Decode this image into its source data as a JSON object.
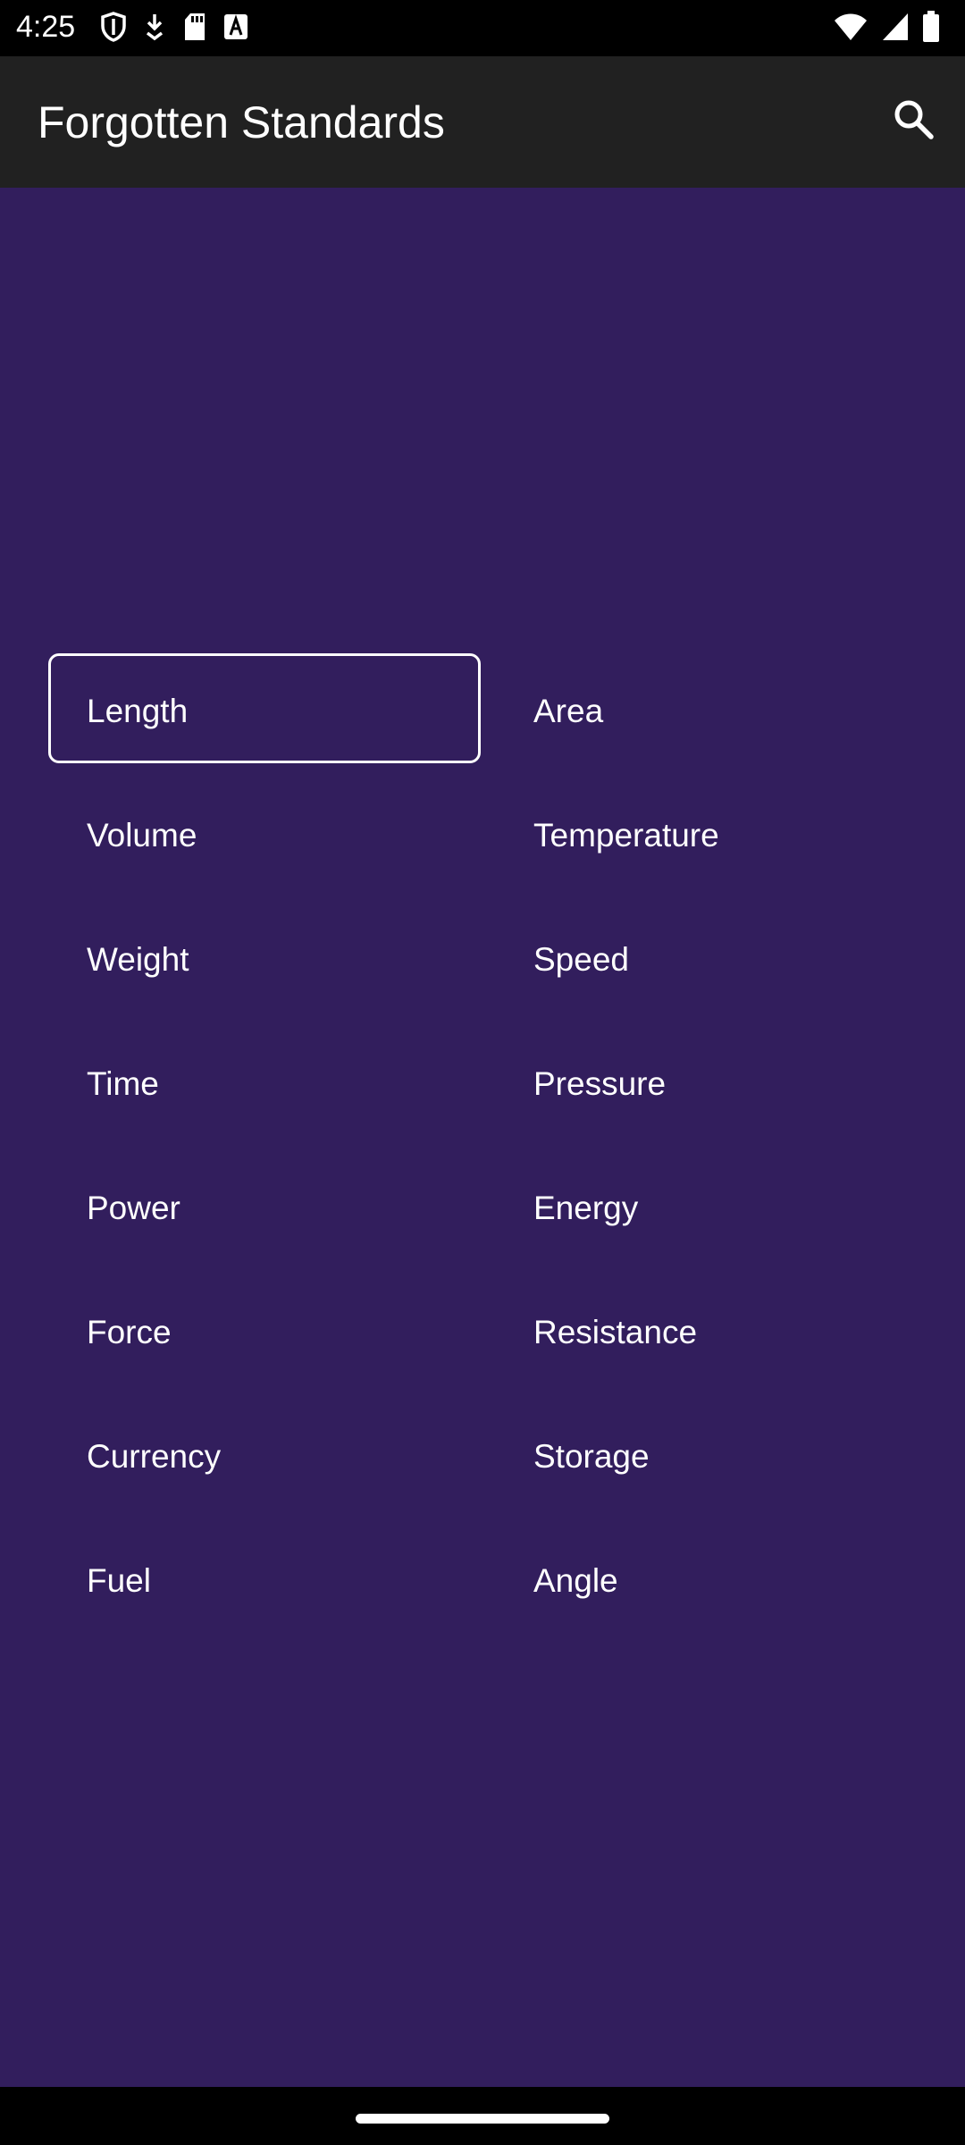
{
  "status_bar": {
    "time": "4:25",
    "left_icons": [
      "shield-icon",
      "download-icon",
      "sd-card-icon",
      "text-a-icon"
    ],
    "right_icons": [
      "wifi-icon",
      "signal-icon",
      "battery-icon"
    ]
  },
  "app_bar": {
    "title": "Forgotten Standards",
    "search_icon": "search-icon"
  },
  "units": {
    "items": [
      {
        "label": "Length",
        "selected": true
      },
      {
        "label": "Area",
        "selected": false
      },
      {
        "label": "Volume",
        "selected": false
      },
      {
        "label": "Temperature",
        "selected": false
      },
      {
        "label": "Weight",
        "selected": false
      },
      {
        "label": "Speed",
        "selected": false
      },
      {
        "label": "Time",
        "selected": false
      },
      {
        "label": "Pressure",
        "selected": false
      },
      {
        "label": "Power",
        "selected": false
      },
      {
        "label": "Energy",
        "selected": false
      },
      {
        "label": "Force",
        "selected": false
      },
      {
        "label": "Resistance",
        "selected": false
      },
      {
        "label": "Currency",
        "selected": false
      },
      {
        "label": "Storage",
        "selected": false
      },
      {
        "label": "Fuel",
        "selected": false
      },
      {
        "label": "Angle",
        "selected": false
      }
    ]
  },
  "colors": {
    "background": "#321e5d",
    "app_bar": "#212121",
    "text": "#ffffff"
  }
}
